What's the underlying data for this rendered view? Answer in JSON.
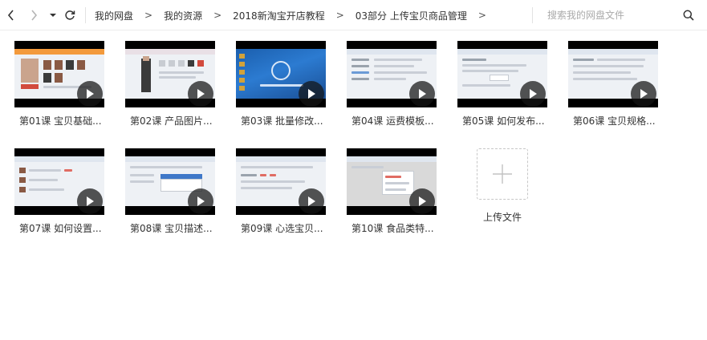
{
  "toolbar": {
    "breadcrumbs": [
      "我的网盘",
      "我的资源",
      "2018新淘宝开店教程",
      "03部分 上传宝贝商品管理"
    ],
    "breadcrumb_separator": ">",
    "search_placeholder": "搜索我的网盘文件"
  },
  "files": [
    {
      "name": "第01课 宝贝基础..."
    },
    {
      "name": "第02课 产品图片..."
    },
    {
      "name": "第03课 批量修改..."
    },
    {
      "name": "第04课 运费模板..."
    },
    {
      "name": "第05课 如何发布..."
    },
    {
      "name": "第06课 宝贝规格..."
    },
    {
      "name": "第07课 如何设置..."
    },
    {
      "name": "第08课 宝贝描述..."
    },
    {
      "name": "第09课 心选宝贝..."
    },
    {
      "name": "第10课 食品类特..."
    }
  ],
  "upload": {
    "label": "上传文件"
  },
  "colors": {
    "accent": "#333333",
    "thumb_bg": "#000000",
    "desktop_blue": "#1b5fae"
  }
}
